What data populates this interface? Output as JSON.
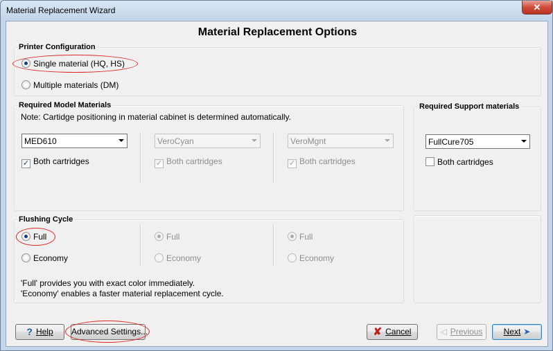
{
  "window": {
    "title": "Material Replacement Wizard"
  },
  "heading": "Material Replacement Options",
  "printer_config": {
    "legend": "Printer Configuration",
    "options": [
      "Single material (HQ, HS)",
      "Multiple materials (DM)"
    ],
    "selected": "Single material (HQ, HS)"
  },
  "model_materials": {
    "legend": "Required Model Materials",
    "note": "Note: Cartidge positioning in material cabinet is determined automatically.",
    "columns": [
      {
        "material": "MED610",
        "both_label": "Both cartridges",
        "both_checked": true,
        "enabled": true
      },
      {
        "material": "VeroCyan",
        "both_label": "Both cartridges",
        "both_checked": true,
        "enabled": false
      },
      {
        "material": "VeroMgnt",
        "both_label": "Both cartridges",
        "both_checked": true,
        "enabled": false
      }
    ]
  },
  "support_materials": {
    "legend": "Required Support materials",
    "material": "FullCure705",
    "both_label": "Both cartridges",
    "both_checked": false
  },
  "flushing": {
    "legend": "Flushing Cycle",
    "columns": [
      {
        "full": "Full",
        "economy": "Economy",
        "selected": "Full",
        "enabled": true
      },
      {
        "full": "Full",
        "economy": "Economy",
        "selected": "Full",
        "enabled": false
      },
      {
        "full": "Full",
        "economy": "Economy",
        "selected": "Full",
        "enabled": false
      }
    ],
    "info_line1": "'Full' provides you with exact color immediately.",
    "info_line2": "'Economy' enables a faster material replacement cycle."
  },
  "buttons": {
    "help": "Help",
    "advanced": "Advanced Settings...",
    "cancel": "Cancel",
    "previous": "Previous",
    "next": "Next"
  },
  "colors": {
    "highlight": "#e02424",
    "selection": "#14388a"
  }
}
